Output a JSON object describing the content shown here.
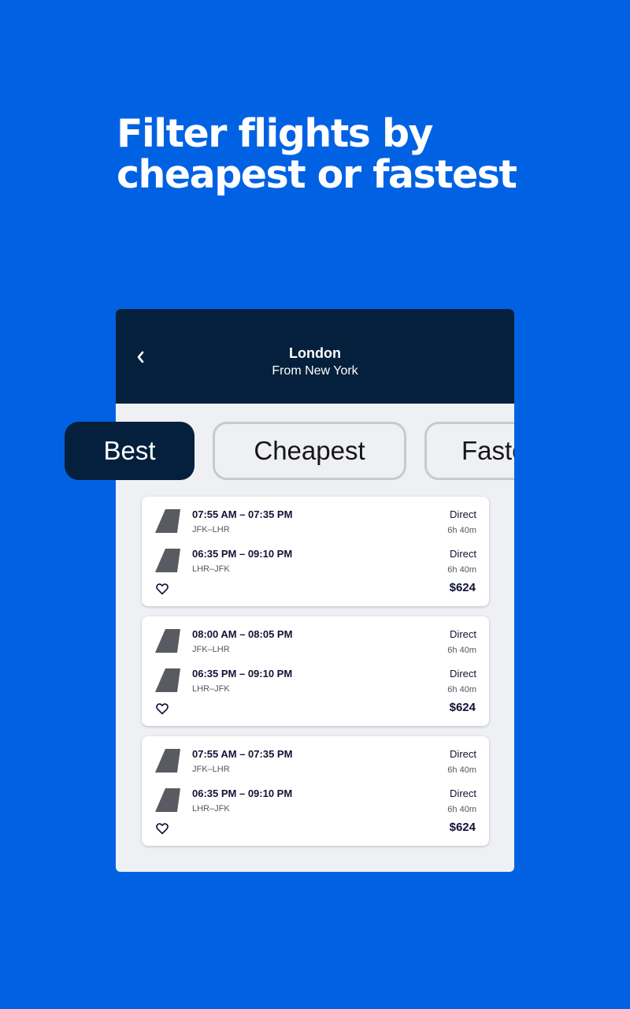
{
  "headline": {
    "line1": "Filter flights by",
    "line2": "cheapest or fastest"
  },
  "appbar": {
    "title": "London",
    "subtitle": "From New York",
    "back_icon": "chevron-left-icon"
  },
  "filters": [
    {
      "label": "Best",
      "selected": true
    },
    {
      "label": "Cheapest",
      "selected": false
    },
    {
      "label": "Fastest",
      "selected": false
    }
  ],
  "results": [
    {
      "outbound": {
        "times": "07:55 AM – 07:35 PM",
        "route": "JFK–LHR",
        "stops": "Direct",
        "duration": "6h 40m"
      },
      "inbound": {
        "times": "06:35 PM – 09:10 PM",
        "route": "LHR–JFK",
        "stops": "Direct",
        "duration": "6h 40m"
      },
      "price": "$624"
    },
    {
      "outbound": {
        "times": "08:00 AM – 08:05 PM",
        "route": "JFK–LHR",
        "stops": "Direct",
        "duration": "6h 40m"
      },
      "inbound": {
        "times": "06:35 PM – 09:10 PM",
        "route": "LHR–JFK",
        "stops": "Direct",
        "duration": "6h 40m"
      },
      "price": "$624"
    },
    {
      "outbound": {
        "times": "07:55 AM – 07:35 PM",
        "route": "JFK–LHR",
        "stops": "Direct",
        "duration": "6h 40m"
      },
      "inbound": {
        "times": "06:35 PM – 09:10 PM",
        "route": "LHR–JFK",
        "stops": "Direct",
        "duration": "6h 40m"
      },
      "price": "$624"
    }
  ],
  "colors": {
    "background": "#0062e3",
    "appbar": "#05203c",
    "panel": "#eff0f4",
    "airline_tail": "#5a5b62"
  }
}
